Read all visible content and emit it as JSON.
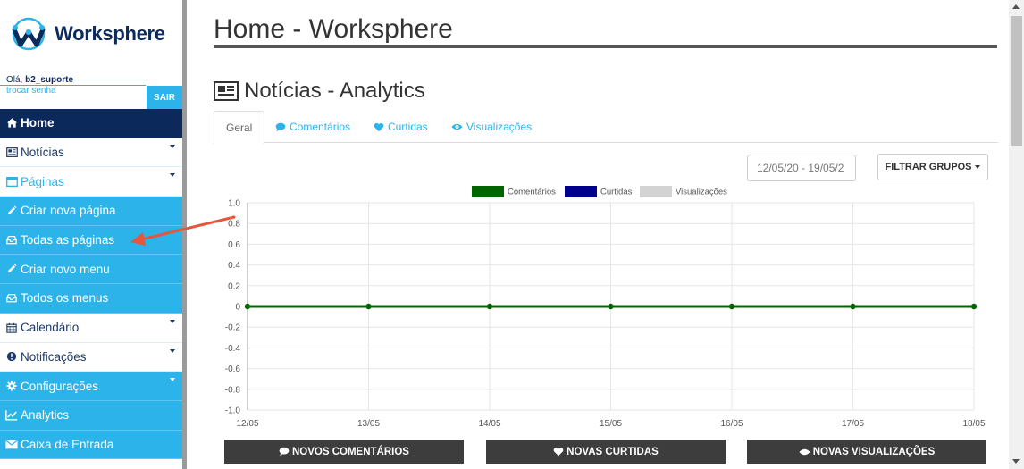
{
  "brand": {
    "name": "Worksphere",
    "accent": "#2bb3ea",
    "navy": "#0b2a5b"
  },
  "user": {
    "greeting": "Olá,",
    "username": "b2_suporte",
    "change_password": "trocar senha",
    "logout": "SAIR"
  },
  "menu": [
    {
      "label": "Home",
      "icon": "home-icon",
      "style": "home",
      "has_caret": false
    },
    {
      "label": "Notícias",
      "icon": "newspaper-icon",
      "style": "white",
      "has_caret": true
    },
    {
      "label": "Páginas",
      "icon": "window-icon",
      "style": "white-sel",
      "has_caret": true
    },
    {
      "label": "Criar nova página",
      "icon": "pencil-icon",
      "style": "blue",
      "has_caret": false
    },
    {
      "label": "Todas as páginas",
      "icon": "inbox-icon",
      "style": "blue",
      "has_caret": false
    },
    {
      "label": "Criar novo menu",
      "icon": "pencil-icon",
      "style": "blue",
      "has_caret": false
    },
    {
      "label": "Todos os menus",
      "icon": "inbox-icon",
      "style": "blue",
      "has_caret": false
    },
    {
      "label": "Calendário",
      "icon": "calendar-icon",
      "style": "white",
      "has_caret": true
    },
    {
      "label": "Notificações",
      "icon": "exclamation-icon",
      "style": "white",
      "has_caret": true
    },
    {
      "label": "Configurações",
      "icon": "gear-icon",
      "style": "blue",
      "has_caret": true
    },
    {
      "label": "Analytics",
      "icon": "line-chart-icon",
      "style": "blue",
      "has_caret": false
    },
    {
      "label": "Caixa de Entrada",
      "icon": "envelope-icon",
      "style": "blue",
      "has_caret": false
    }
  ],
  "page": {
    "title": "Home - Worksphere",
    "section_title": "Notícias - Analytics"
  },
  "tabs": [
    {
      "label": "Geral",
      "icon": "",
      "active": true
    },
    {
      "label": "Comentários",
      "icon": "comment-icon",
      "active": false
    },
    {
      "label": "Curtidas",
      "icon": "heart-icon",
      "active": false
    },
    {
      "label": "Visualizações",
      "icon": "eye-icon",
      "active": false
    }
  ],
  "filters": {
    "date_range": "12/05/20 - 19/05/2",
    "group_button": "FILTRAR GRUPOS"
  },
  "chart_data": {
    "type": "line",
    "x": [
      "12/05",
      "13/05",
      "14/05",
      "15/05",
      "16/05",
      "17/05",
      "18/05"
    ],
    "series": [
      {
        "name": "Comentários",
        "values": [
          0,
          0,
          0,
          0,
          0,
          0,
          0
        ],
        "color": "#006400"
      },
      {
        "name": "Curtidas",
        "values": [
          0,
          0,
          0,
          0,
          0,
          0,
          0
        ],
        "color": "#00008b"
      },
      {
        "name": "Visualizações",
        "values": [
          0,
          0,
          0,
          0,
          0,
          0,
          0
        ],
        "color": "#d3d3d3"
      }
    ],
    "y_ticks": [
      "1.0",
      "0.8",
      "0.6",
      "0.4",
      "0.2",
      "0",
      "-0.2",
      "-0.4",
      "-0.6",
      "-0.8",
      "-1.0"
    ],
    "ylim": [
      -1,
      1
    ],
    "grid": true,
    "legend_position": "top-center"
  },
  "footer_buttons": [
    {
      "label": "NOVOS COMENTÁRIOS",
      "icon": "comment-icon"
    },
    {
      "label": "NOVAS CURTIDAS",
      "icon": "heart-icon"
    },
    {
      "label": "NOVAS VISUALIZAÇÕES",
      "icon": "eye-icon"
    }
  ]
}
